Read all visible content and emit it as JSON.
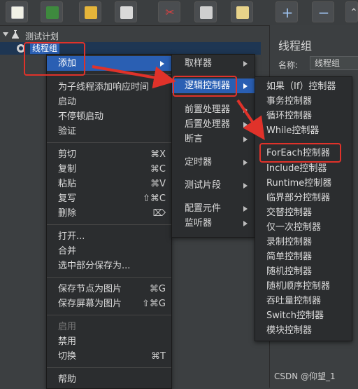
{
  "colors": {
    "accent": "#2a5fb3",
    "annotation": "#e0322a",
    "background": "#3c3f41",
    "menu_bg": "#2b2d2f"
  },
  "toolbar": {
    "buttons": [
      {
        "name": "new-icon"
      },
      {
        "name": "templates-icon"
      },
      {
        "name": "open-icon"
      },
      {
        "name": "save-icon"
      },
      {
        "name": "cut-icon"
      },
      {
        "name": "copy-icon"
      },
      {
        "name": "paste-icon"
      },
      {
        "name": "add-icon",
        "glyph": "+"
      },
      {
        "name": "remove-icon",
        "glyph": "−"
      },
      {
        "name": "browse-icon",
        "glyph": "⌃"
      }
    ]
  },
  "tree": {
    "test_plan": "测试计划",
    "thread_group": "线程组"
  },
  "panel": {
    "title": "线程组",
    "name_label": "名称:",
    "name_value": "线程组"
  },
  "context_menu": {
    "add": "添加",
    "add_response_time": "为子线程添加响应时间",
    "start": "启动",
    "start_no_pause": "不停顿启动",
    "validate": "验证",
    "cut": "剪切",
    "cut_sc": "⌘X",
    "copy": "复制",
    "copy_sc": "⌘C",
    "paste": "粘贴",
    "paste_sc": "⌘V",
    "duplicate": "复写",
    "duplicate_sc": "⇧⌘C",
    "delete": "删除",
    "delete_sc": "⌦",
    "open": "打开...",
    "merge": "合并",
    "save_selection_as": "选中部分保存为...",
    "save_node_image": "保存节点为图片",
    "save_node_image_sc": "⌘G",
    "save_screen_image": "保存屏幕为图片",
    "save_screen_image_sc": "⇧⌘G",
    "enable": "启用",
    "disable": "禁用",
    "toggle": "切换",
    "toggle_sc": "⌘T",
    "help": "帮助"
  },
  "add_menu": {
    "sampler": "取样器",
    "logic_controller": "逻辑控制器",
    "pre_processor": "前置处理器",
    "post_processor": "后置处理器",
    "assertion": "断言",
    "timer": "定时器",
    "test_fragment": "测试片段",
    "config_element": "配置元件",
    "listener": "监听器"
  },
  "logic_menu": {
    "items": [
      "如果（If）控制器",
      "事务控制器",
      "循环控制器",
      "While控制器",
      "ForEach控制器",
      "Include控制器",
      "Runtime控制器",
      "临界部分控制器",
      "交替控制器",
      "仅一次控制器",
      "录制控制器",
      "简单控制器",
      "随机控制器",
      "随机顺序控制器",
      "吞吐量控制器",
      "Switch控制器",
      "模块控制器"
    ]
  },
  "watermark": "CSDN @仰望_1"
}
